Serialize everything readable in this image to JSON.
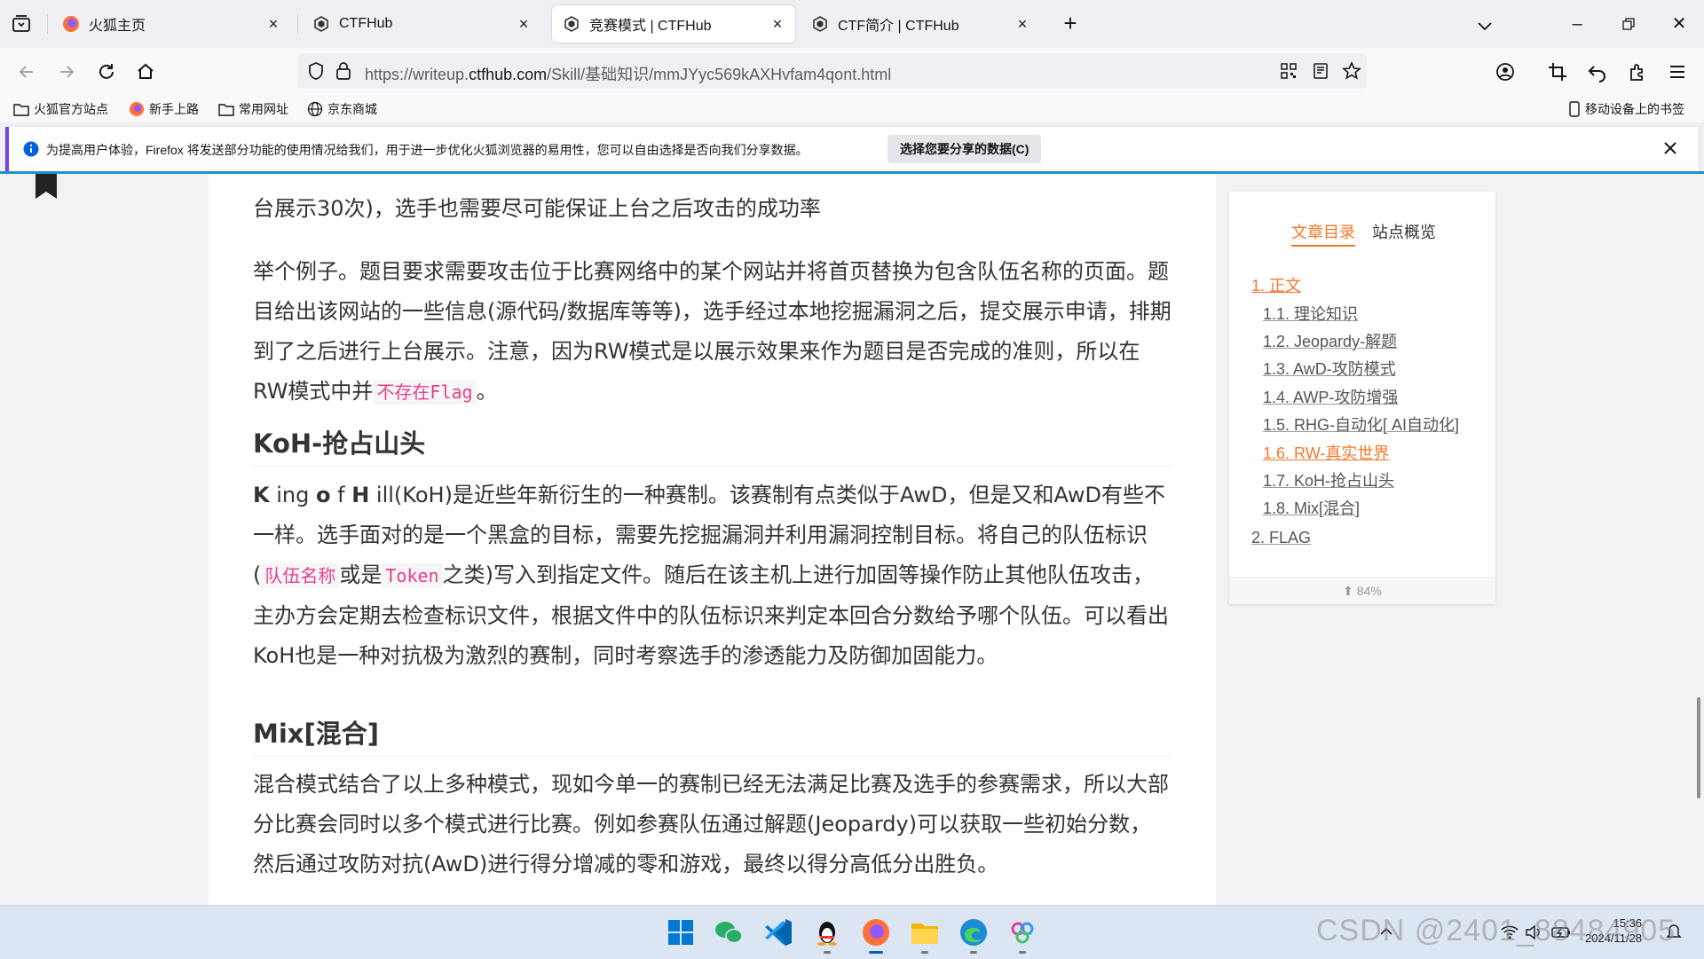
{
  "tabs": [
    {
      "title": "火狐主页"
    },
    {
      "title": "CTFHub"
    },
    {
      "title": "竞赛模式 | CTFHub"
    },
    {
      "title": "CTF简介 | CTFHub"
    }
  ],
  "url": {
    "prefix": "https://writeup.",
    "host": "ctfhub.com",
    "path": "/Skill/基础知识/mmJYyc569kAXHvfam4qont.html"
  },
  "bookmarks": [
    {
      "label": "火狐官方站点"
    },
    {
      "label": "新手上路"
    },
    {
      "label": "常用网址"
    },
    {
      "label": "京东商城"
    }
  ],
  "mobile_bookmarks": "移动设备上的书签",
  "notification": {
    "message": "为提高用户体验，Firefox 将发送部分功能的使用情况给我们，用于进一步优化火狐浏览器的易用性，您可以自由选择是否向我们分享数据。",
    "button": "选择您要分享的数据(C)"
  },
  "article": {
    "p0": "台展示30次)，选手也需要尽可能保证上台之后攻击的成功率",
    "p1_a": "举个例子。题目要求需要攻击位于比赛网络中的某个网站并将首页替换为包含队伍名称的页面。题目给出该网站的一些信息(源代码/数据库等等)，选手经过本地挖掘漏洞之后，提交展示申请，排期到了之后进行上台展示。注意，因为RW模式是以展示效果来作为题目是否完成的准则，所以在RW模式中并",
    "p1_code": "不存在Flag",
    "p1_end": "。",
    "h_koh": "KoH-抢占山头",
    "koh_k": "K",
    "koh_ing": " ing ",
    "koh_o": "o",
    "koh_f": " f ",
    "koh_h": "H",
    "koh_rest": " ill(KoH)是近些年新衍生的一种赛制。该赛制有点类似于AwD，但是又和AwD有些不一样。选手面对的是一个黑盒的目标，需要先挖掘漏洞并利用漏洞控制目标。将自己的队伍标识(",
    "koh_code1": "队伍名称",
    "koh_mid": "或是",
    "koh_code2": "Token",
    "koh_tail": "之类)写入到指定文件。随后在该主机上进行加固等操作防止其他队伍攻击，主办方会定期去检查标识文件，根据文件中的队伍标识来判定本回合分数给予哪个队伍。可以看出KoH也是一种对抗极为激烈的赛制，同时考察选手的渗透能力及防御加固能力。",
    "h_mix": "Mix[混合]",
    "p_mix": "混合模式结合了以上多种模式，现如今单一的赛制已经无法满足比赛及选手的参赛需求，所以大部分比赛会同时以多个模式进行比赛。例如参赛队伍通过解题(Jeopardy)可以获取一些初始分数，然后通过攻防对抗(AwD)进行得分增减的零和游戏，最终以得分高低分出胜负。"
  },
  "toc": {
    "tab_active": "文章目录",
    "tab_other": "站点概览",
    "items": [
      {
        "label": "1. 正文"
      },
      {
        "label": "1.1. 理论知识"
      },
      {
        "label": "1.2. Jeopardy-解题"
      },
      {
        "label": "1.3. AwD-攻防模式"
      },
      {
        "label": "1.4. AWP-攻防增强"
      },
      {
        "label": "1.5. RHG-自动化[ AI自动化]"
      },
      {
        "label": "1.6. RW-真实世界"
      },
      {
        "label": "1.7. KoH-抢占山头"
      },
      {
        "label": "1.8. Mix[混合]"
      },
      {
        "label": "2. FLAG"
      }
    ],
    "progress": "84%"
  },
  "taskbar": {
    "time": "15:36",
    "date": "2024/11/28",
    "watermark": "CSDN @2401_88484905"
  },
  "colors": {
    "accent": "#f4782a",
    "code": "#e83e8c",
    "firefox_purple": "#7542e5"
  }
}
